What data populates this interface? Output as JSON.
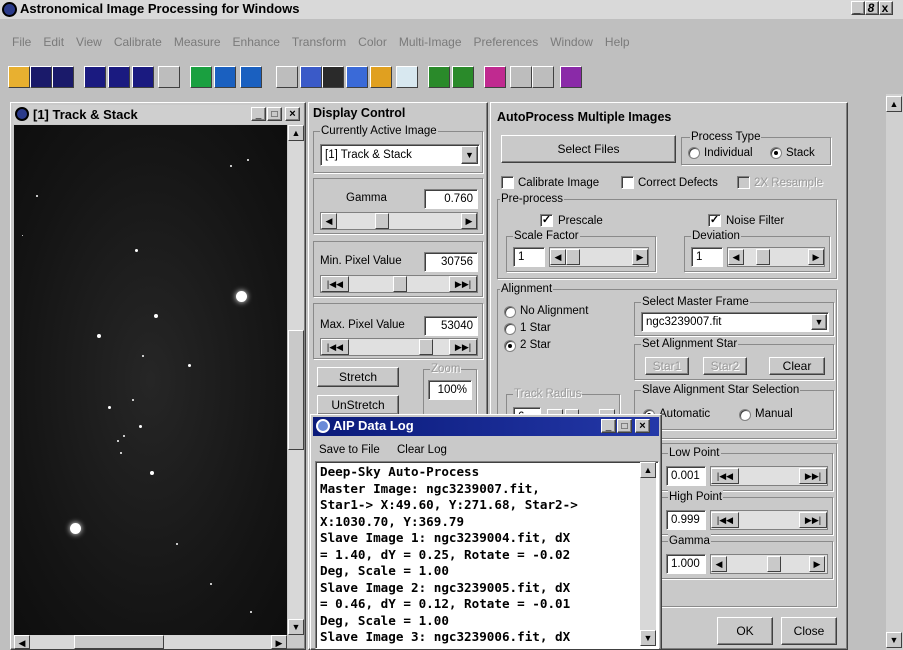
{
  "app": {
    "title": "Astronomical Image Processing for Windows",
    "win_controls": "_ 8 x"
  },
  "menu": [
    "File",
    "Edit",
    "View",
    "Calibrate",
    "Measure",
    "Enhance",
    "Transform",
    "Color",
    "Multi-Image",
    "Preferences",
    "Window",
    "Help"
  ],
  "toolbar": {
    "buttons": [
      "open",
      "save",
      "save-all",
      "layout-1",
      "layout-2",
      "layout-3",
      "blank",
      "stretch-1",
      "stretch-2",
      "stretch-3",
      "dde",
      "ddp",
      "crop",
      "image",
      "fft",
      "register",
      "compare",
      "star",
      "color",
      "blank2",
      "blank3",
      "book"
    ]
  },
  "image_window": {
    "title": "[1] Track & Stack"
  },
  "display_control": {
    "title": "Display Control",
    "active_label": "Currently Active Image",
    "active_value": "[1] Track & Stack",
    "gamma_label": "Gamma",
    "gamma_value": "0.760",
    "min_label": "Min. Pixel Value",
    "min_value": "30756",
    "max_label": "Max. Pixel Value",
    "max_value": "53040",
    "stretch": "Stretch",
    "unstretch": "UnStretch",
    "zoom_label": "Zoom",
    "zoom_value": "100%"
  },
  "autoprocess": {
    "title": "AutoProcess Multiple Images",
    "select_files": "Select Files",
    "process_type": "Process Type",
    "individual": "Individual",
    "stack": "Stack",
    "calibrate": "Calibrate Image",
    "correct": "Correct Defects",
    "resample": "2X Resample",
    "preprocess": "Pre-process",
    "prescale": "Prescale",
    "noise": "Noise Filter",
    "scale_factor": "Scale Factor",
    "scale_value": "1",
    "deviation": "Deviation",
    "deviation_value": "1",
    "alignment": "Alignment",
    "no_align": "No Alignment",
    "one_star": "1 Star",
    "two_star": "2 Star",
    "master": "Select Master Frame",
    "master_value": "ngc3239007.fit",
    "set_star": "Set Alignment Star",
    "star1": "Star1",
    "star2": "Star2",
    "clear": "Clear",
    "track_radius": "Track Radius",
    "track_value": "6",
    "slave_sel": "Slave Alignment Star Selection",
    "automatic": "Automatic",
    "manual": "Manual",
    "low_point": "Low Point",
    "low_value": "0.001",
    "high_point": "High Point",
    "high_value": "0.999",
    "gamma": "Gamma",
    "gamma_value": "1.000",
    "ok": "OK",
    "close": "Close"
  },
  "log": {
    "title": "AIP Data Log",
    "save": "Save to File",
    "clear": "Clear Log",
    "lines": [
      "Deep-Sky Auto-Process",
      "Master Image: ngc3239007.fit,",
      "Star1-> X:49.60, Y:271.68, Star2->",
      "X:1030.70, Y:369.79",
      "Slave Image 1: ngc3239004.fit, dX",
      "= 1.40, dY = 0.25, Rotate = -0.02",
      "Deg, Scale = 1.00",
      "Slave Image 2: ngc3239005.fit, dX",
      "= 0.46, dY = 0.12, Rotate = -0.01",
      "Deg, Scale = 1.00",
      "Slave Image 3: ngc3239006.fit, dX"
    ]
  }
}
